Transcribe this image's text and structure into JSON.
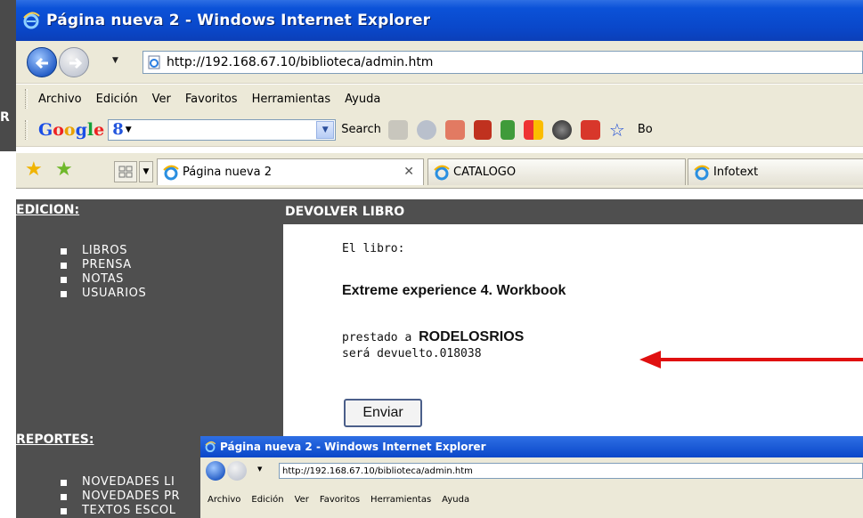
{
  "window": {
    "title": "Página nueva 2 - Windows Internet Explorer",
    "url": "http://192.168.67.10/biblioteca/admin.htm"
  },
  "menu": [
    "Archivo",
    "Edición",
    "Ver",
    "Favoritos",
    "Herramientas",
    "Ayuda"
  ],
  "google_toolbar": {
    "logo": [
      "G",
      "o",
      "o",
      "g",
      "l",
      "e"
    ],
    "search_label": "Search",
    "cut_label": "Bo"
  },
  "tabs": [
    {
      "label": "Página nueva 2"
    },
    {
      "label": "CATALOGO"
    },
    {
      "label": "Infotext"
    }
  ],
  "sidebar": {
    "edicion_title": "EDICION:",
    "edicion_items": [
      "LIBROS",
      "PRENSA",
      "NOTAS",
      "USUARIOS"
    ],
    "reportes_title": "REPORTES:",
    "reportes_items": [
      "NOVEDADES LI",
      "NOVEDADES PR",
      "TEXTOS ESCOL"
    ]
  },
  "main": {
    "heading": "DEVOLVER LIBRO",
    "el_libro": "El libro:",
    "book_title": "Extreme experience 4. Workbook",
    "prestado_prefix": "prestado a ",
    "prestado_name": "RODELOSRIOS",
    "devuelto": "será devuelto.018038",
    "submit": "Enviar"
  },
  "underlying_window": {
    "letter": "R"
  },
  "mini_window": {
    "title": "Página nueva 2 - Windows Internet Explorer",
    "url": "http://192.168.67.10/biblioteca/admin.htm",
    "menu": [
      "Archivo",
      "Edición",
      "Ver",
      "Favoritos",
      "Herramientas",
      "Ayuda"
    ]
  },
  "colors": {
    "titlebar": "#0b52d8",
    "sidebar_bg": "#4f4f4f",
    "arrow": "#e01010"
  }
}
